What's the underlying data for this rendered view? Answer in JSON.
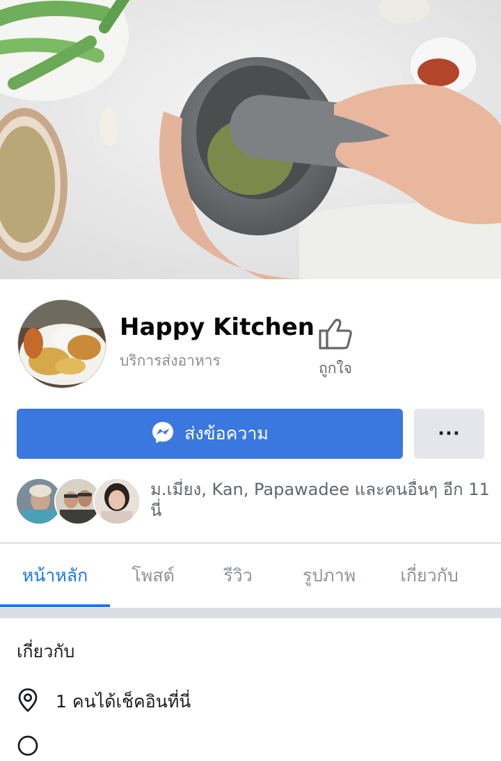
{
  "page": {
    "name": "Happy Kitchen",
    "category": "บริการส่งอาหาร"
  },
  "like_button": {
    "label": "ถูกใจ",
    "icon": "thumbs-up-icon"
  },
  "actions": {
    "message_label": "ส่งข้อความ",
    "message_icon": "messenger-icon",
    "more_label": "···"
  },
  "friends": {
    "text_line1": "ม.เมี่ยง, Kan, Papawadee และคนอื่นๆ อีก 11",
    "text_line2": "นี่"
  },
  "tabs": [
    {
      "label": "หน้าหลัก",
      "active": true
    },
    {
      "label": "โพสต์",
      "active": false
    },
    {
      "label": "รีวิว",
      "active": false
    },
    {
      "label": "รูปภาพ",
      "active": false
    },
    {
      "label": "เกี่ยวกับ",
      "active": false
    }
  ],
  "about": {
    "title": "เกี่ยวกับ",
    "checkins": "1 คนได้เช็คอินที่นี่"
  },
  "colors": {
    "accent": "#1877f2",
    "message_button": "#3a78e0"
  }
}
